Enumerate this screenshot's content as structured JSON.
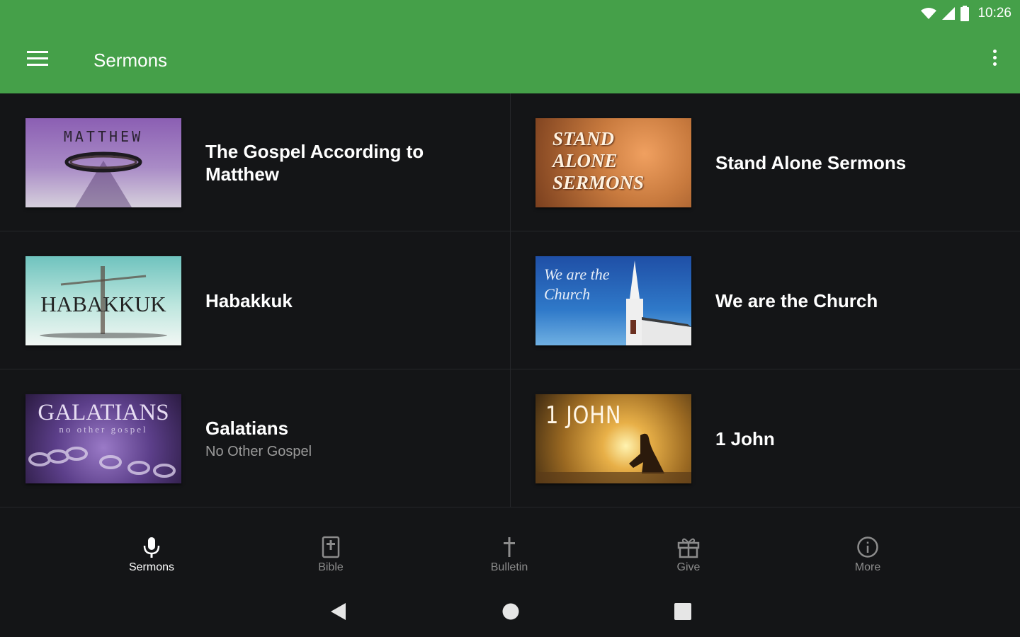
{
  "status_bar": {
    "time": "10:26"
  },
  "app_bar": {
    "title": "Sermons"
  },
  "series": [
    {
      "title": "The Gospel According to Matthew",
      "subtitle": "",
      "thumb_text": "MATTHEW"
    },
    {
      "title": "Stand Alone Sermons",
      "subtitle": "",
      "thumb_text": "STAND ALONE SERMONS"
    },
    {
      "title": "Habakkuk",
      "subtitle": "",
      "thumb_text": "HABAKKUK"
    },
    {
      "title": "We are the Church",
      "subtitle": "",
      "thumb_text": "We are the Church"
    },
    {
      "title": "Galatians",
      "subtitle": "No Other Gospel",
      "thumb_text": "GALATIANS",
      "thumb_subtext": "no other gospel"
    },
    {
      "title": "1 John",
      "subtitle": "",
      "thumb_text": "1 JOHN"
    }
  ],
  "bottom_nav": [
    {
      "label": "Sermons",
      "icon": "microphone-icon",
      "active": true
    },
    {
      "label": "Bible",
      "icon": "bible-icon",
      "active": false
    },
    {
      "label": "Bulletin",
      "icon": "cross-icon",
      "active": false
    },
    {
      "label": "Give",
      "icon": "gift-icon",
      "active": false
    },
    {
      "label": "More",
      "icon": "info-icon",
      "active": false
    }
  ],
  "colors": {
    "primary": "#45a049",
    "background": "#141517",
    "inactive": "#8c8c8c"
  }
}
